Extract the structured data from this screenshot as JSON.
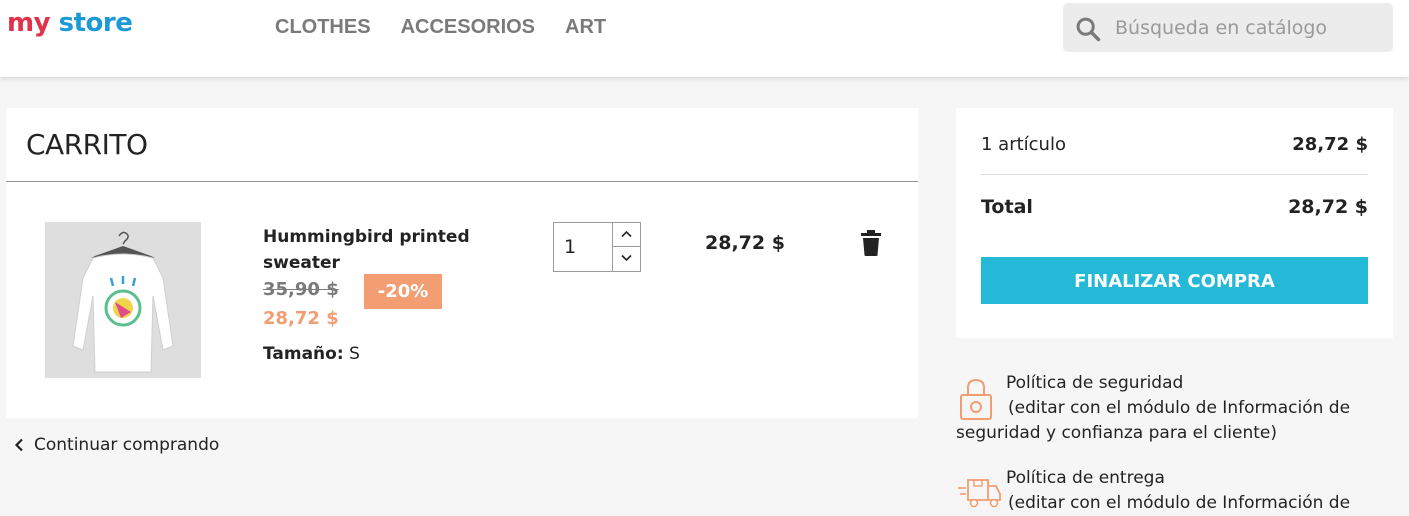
{
  "header": {
    "logo": {
      "part1": "my",
      "part2": " store"
    },
    "nav": [
      "CLOTHES",
      "ACCESORIOS",
      "ART"
    ],
    "search": {
      "placeholder": "Búsqueda en catálogo",
      "icon": "search-icon"
    }
  },
  "cart": {
    "title": "CARRITO",
    "item": {
      "name": "Hummingbird printed sweater",
      "old_price": "35,90 $",
      "discount": "-20%",
      "price": "28,72 $",
      "size_label": "Tamaño:",
      "size_value": "S",
      "quantity": "1",
      "line_total": "28,72 $"
    },
    "continue_label": "Continuar comprando"
  },
  "summary": {
    "items_label": "1 artículo",
    "items_value": "28,72 $",
    "total_label": "Total",
    "total_value": "28,72 $",
    "checkout_label": "FINALIZAR COMPRA"
  },
  "reassurance": [
    {
      "title": "Política de seguridad",
      "desc": "(editar con el módulo de Información de seguridad y confianza para el cliente)",
      "icon": "lock-icon"
    },
    {
      "title": "Política de entrega",
      "desc": "(editar con el módulo de Información de",
      "icon": "truck-icon"
    }
  ],
  "colors": {
    "accent": "#24b9d7",
    "discount": "#f39d72",
    "page_bg": "#f6f6f6"
  }
}
